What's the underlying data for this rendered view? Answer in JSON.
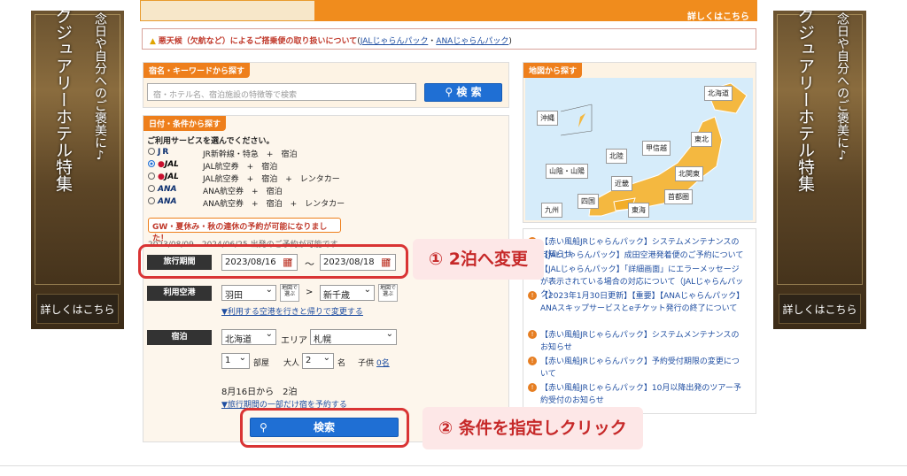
{
  "side_banner": {
    "line1": "念日や自分へのご褒美に♪",
    "line2": "グジュアリーホテル特集",
    "details_label": "詳しくはこちら"
  },
  "top_banner": {
    "link_text": "詳しくはこちら"
  },
  "notice": {
    "warning": "悪天候（欠航など）によるご搭乗便の取り扱いについて",
    "link1": "JALじゃらんパック",
    "sep": "・",
    "link2": "ANAじゃらんパック",
    "open": "(",
    "close": ")"
  },
  "keyword_search": {
    "header": "宿名・キーワードから探す",
    "placeholder": "宿・ホテル名、宿泊施設の特徴等で検索",
    "button": "検 索"
  },
  "conditions": {
    "header": "日付・条件から探す",
    "service_prompt": "ご利用サービスを選んでください。",
    "services": [
      {
        "logo": "JR",
        "desc": "JR新幹線・特急　+　宿泊",
        "selected": false
      },
      {
        "logo": "JAL",
        "desc": "JAL航空券　+　宿泊",
        "selected": true
      },
      {
        "logo": "JAL",
        "desc": "JAL航空券　+　宿泊　+　レンタカー",
        "selected": false
      },
      {
        "logo": "ANA",
        "desc": "ANA航空券　+　宿泊",
        "selected": false
      },
      {
        "logo": "ANA",
        "desc": "ANA航空券　+　宿泊　+　レンタカー",
        "selected": false
      }
    ],
    "holiday_notice": "GW・夏休み・秋の連休の予約が可能になりました！",
    "period_note": "2023/08/09 - 2024/06/25 出発のご予約が可能です",
    "travel_period_label": "旅行期間",
    "date_from": "2023/08/16",
    "date_to": "2023/08/18",
    "tilde": "～",
    "airport_label": "利用空港",
    "dep_airport": "羽田",
    "arr_airport": "新千歳",
    "map_select": "地図で選ぶ",
    "arrow": ">",
    "diff_airport_link": "▼利用する空港を行きと帰りで変更する",
    "stay_label": "宿泊",
    "prefecture": "北海道",
    "area_label": "エリア",
    "area": "札幌",
    "rooms": "1",
    "rooms_unit": "部屋",
    "adults_label": "大人",
    "adults": "2",
    "adults_unit": "名",
    "children_label": "子供",
    "children_link": "0名",
    "stay_summary": "8月16日から　2泊",
    "partial_stay_link": "▼旅行期間の一部だけ宿を予約する",
    "search_button": "検索"
  },
  "map_search": {
    "header": "地図から探す",
    "regions": [
      "北海道",
      "東北",
      "沖縄",
      "北陸",
      "甲信越",
      "山陰・山陽",
      "近畿",
      "北関東",
      "九州",
      "四国",
      "東海",
      "首都圏"
    ]
  },
  "news": [
    "【赤い風船JRじゃらんパック】システムメンテナンスのお知らせ",
    "【JALじゃらんパック】成田空港発着便のご予約について",
    "【JALじゃらんパック】「詳細画面」にエラーメッセージが表示されている場合の対応について（JALじゃらんパック）",
    "【2023年1月30日更新】【重要】【ANAじゃらんパック】ANAスキップサービスとeチケット発行の終了について",
    "【赤い風船JRじゃらんパック】システムメンテナンスのお知らせ",
    "【赤い風船JRじゃらんパック】予約受付期限の変更について",
    "【赤い風船JRじゃらんパック】10月以降出発のツアー予約受付のお知らせ"
  ],
  "annotations": {
    "step1": "① 2泊へ変更",
    "step2": "② 条件を指定しクリック"
  },
  "colors": {
    "accent_orange": "#ee7f1c",
    "button_blue": "#1f6fd4",
    "highlight_red": "#d93434"
  }
}
